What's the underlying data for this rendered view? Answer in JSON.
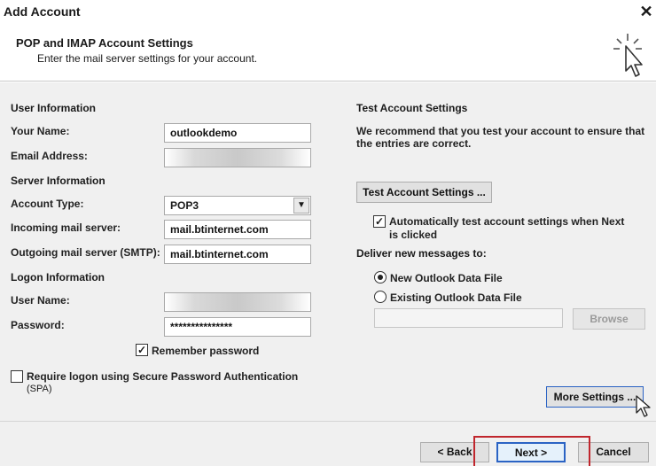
{
  "window": {
    "title": "Add Account",
    "close": "✕"
  },
  "header": {
    "title": "POP and IMAP Account Settings",
    "subtitle": "Enter the mail server settings for your account."
  },
  "user_info": {
    "section": "User Information",
    "name_label": "Your Name:",
    "name_value": "outlookdemo",
    "email_label": "Email Address:",
    "email_value": ""
  },
  "server_info": {
    "section": "Server Information",
    "account_type_label": "Account Type:",
    "account_type_value": "POP3",
    "incoming_label": "Incoming mail server:",
    "incoming_value": "mail.btinternet.com",
    "outgoing_label": "Outgoing mail server (SMTP):",
    "outgoing_value": "mail.btinternet.com"
  },
  "logon_info": {
    "section": "Logon Information",
    "user_label": "User Name:",
    "user_value": "",
    "password_label": "Password:",
    "password_value": "***************",
    "remember_label": "Remember password",
    "remember_checked": true,
    "spa_label_line1": "Require logon using Secure Password Authentication",
    "spa_label_line2": "(SPA)",
    "spa_checked": false
  },
  "test_settings": {
    "section": "Test Account Settings",
    "desc_line1": "We recommend that you test your account to ensure that",
    "desc_line2": "the entries are correct.",
    "button": "Test Account Settings ...",
    "auto_line1": "Automatically test account settings when Next",
    "auto_line2": "is clicked",
    "auto_checked": true
  },
  "deliver": {
    "section": "Deliver new messages to:",
    "option_new": "New Outlook Data File",
    "option_existing": "Existing Outlook Data File",
    "selected": "new",
    "path_value": "",
    "browse": "Browse"
  },
  "more_settings": "More Settings ...",
  "footer": {
    "back": "< Back",
    "next": "Next >",
    "cancel": "Cancel"
  },
  "colors": {
    "highlight": "#c0262d",
    "focus": "#2b63c4"
  }
}
